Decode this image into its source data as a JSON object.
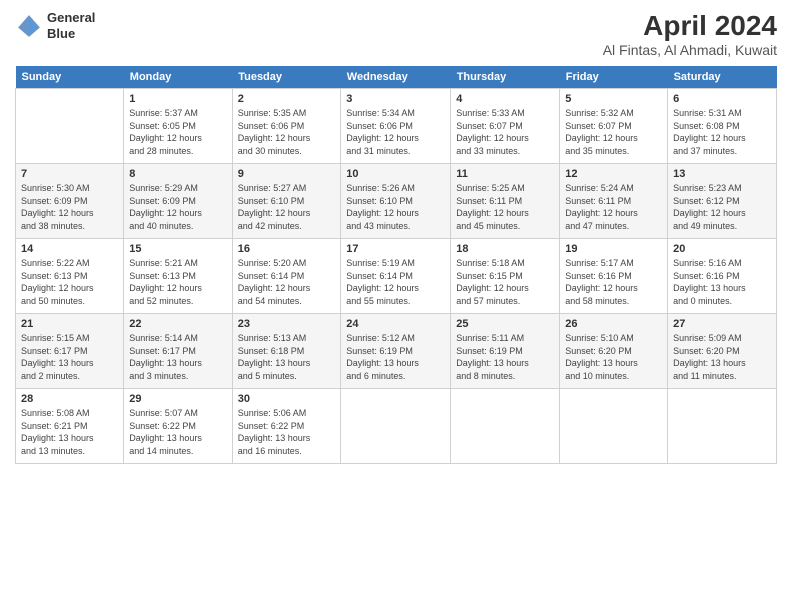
{
  "header": {
    "logo_line1": "General",
    "logo_line2": "Blue",
    "month": "April 2024",
    "location": "Al Fintas, Al Ahmadi, Kuwait"
  },
  "weekdays": [
    "Sunday",
    "Monday",
    "Tuesday",
    "Wednesday",
    "Thursday",
    "Friday",
    "Saturday"
  ],
  "weeks": [
    [
      {
        "day": "",
        "info": ""
      },
      {
        "day": "1",
        "info": "Sunrise: 5:37 AM\nSunset: 6:05 PM\nDaylight: 12 hours\nand 28 minutes."
      },
      {
        "day": "2",
        "info": "Sunrise: 5:35 AM\nSunset: 6:06 PM\nDaylight: 12 hours\nand 30 minutes."
      },
      {
        "day": "3",
        "info": "Sunrise: 5:34 AM\nSunset: 6:06 PM\nDaylight: 12 hours\nand 31 minutes."
      },
      {
        "day": "4",
        "info": "Sunrise: 5:33 AM\nSunset: 6:07 PM\nDaylight: 12 hours\nand 33 minutes."
      },
      {
        "day": "5",
        "info": "Sunrise: 5:32 AM\nSunset: 6:07 PM\nDaylight: 12 hours\nand 35 minutes."
      },
      {
        "day": "6",
        "info": "Sunrise: 5:31 AM\nSunset: 6:08 PM\nDaylight: 12 hours\nand 37 minutes."
      }
    ],
    [
      {
        "day": "7",
        "info": "Sunrise: 5:30 AM\nSunset: 6:09 PM\nDaylight: 12 hours\nand 38 minutes."
      },
      {
        "day": "8",
        "info": "Sunrise: 5:29 AM\nSunset: 6:09 PM\nDaylight: 12 hours\nand 40 minutes."
      },
      {
        "day": "9",
        "info": "Sunrise: 5:27 AM\nSunset: 6:10 PM\nDaylight: 12 hours\nand 42 minutes."
      },
      {
        "day": "10",
        "info": "Sunrise: 5:26 AM\nSunset: 6:10 PM\nDaylight: 12 hours\nand 43 minutes."
      },
      {
        "day": "11",
        "info": "Sunrise: 5:25 AM\nSunset: 6:11 PM\nDaylight: 12 hours\nand 45 minutes."
      },
      {
        "day": "12",
        "info": "Sunrise: 5:24 AM\nSunset: 6:11 PM\nDaylight: 12 hours\nand 47 minutes."
      },
      {
        "day": "13",
        "info": "Sunrise: 5:23 AM\nSunset: 6:12 PM\nDaylight: 12 hours\nand 49 minutes."
      }
    ],
    [
      {
        "day": "14",
        "info": "Sunrise: 5:22 AM\nSunset: 6:13 PM\nDaylight: 12 hours\nand 50 minutes."
      },
      {
        "day": "15",
        "info": "Sunrise: 5:21 AM\nSunset: 6:13 PM\nDaylight: 12 hours\nand 52 minutes."
      },
      {
        "day": "16",
        "info": "Sunrise: 5:20 AM\nSunset: 6:14 PM\nDaylight: 12 hours\nand 54 minutes."
      },
      {
        "day": "17",
        "info": "Sunrise: 5:19 AM\nSunset: 6:14 PM\nDaylight: 12 hours\nand 55 minutes."
      },
      {
        "day": "18",
        "info": "Sunrise: 5:18 AM\nSunset: 6:15 PM\nDaylight: 12 hours\nand 57 minutes."
      },
      {
        "day": "19",
        "info": "Sunrise: 5:17 AM\nSunset: 6:16 PM\nDaylight: 12 hours\nand 58 minutes."
      },
      {
        "day": "20",
        "info": "Sunrise: 5:16 AM\nSunset: 6:16 PM\nDaylight: 13 hours\nand 0 minutes."
      }
    ],
    [
      {
        "day": "21",
        "info": "Sunrise: 5:15 AM\nSunset: 6:17 PM\nDaylight: 13 hours\nand 2 minutes."
      },
      {
        "day": "22",
        "info": "Sunrise: 5:14 AM\nSunset: 6:17 PM\nDaylight: 13 hours\nand 3 minutes."
      },
      {
        "day": "23",
        "info": "Sunrise: 5:13 AM\nSunset: 6:18 PM\nDaylight: 13 hours\nand 5 minutes."
      },
      {
        "day": "24",
        "info": "Sunrise: 5:12 AM\nSunset: 6:19 PM\nDaylight: 13 hours\nand 6 minutes."
      },
      {
        "day": "25",
        "info": "Sunrise: 5:11 AM\nSunset: 6:19 PM\nDaylight: 13 hours\nand 8 minutes."
      },
      {
        "day": "26",
        "info": "Sunrise: 5:10 AM\nSunset: 6:20 PM\nDaylight: 13 hours\nand 10 minutes."
      },
      {
        "day": "27",
        "info": "Sunrise: 5:09 AM\nSunset: 6:20 PM\nDaylight: 13 hours\nand 11 minutes."
      }
    ],
    [
      {
        "day": "28",
        "info": "Sunrise: 5:08 AM\nSunset: 6:21 PM\nDaylight: 13 hours\nand 13 minutes."
      },
      {
        "day": "29",
        "info": "Sunrise: 5:07 AM\nSunset: 6:22 PM\nDaylight: 13 hours\nand 14 minutes."
      },
      {
        "day": "30",
        "info": "Sunrise: 5:06 AM\nSunset: 6:22 PM\nDaylight: 13 hours\nand 16 minutes."
      },
      {
        "day": "",
        "info": ""
      },
      {
        "day": "",
        "info": ""
      },
      {
        "day": "",
        "info": ""
      },
      {
        "day": "",
        "info": ""
      }
    ]
  ]
}
